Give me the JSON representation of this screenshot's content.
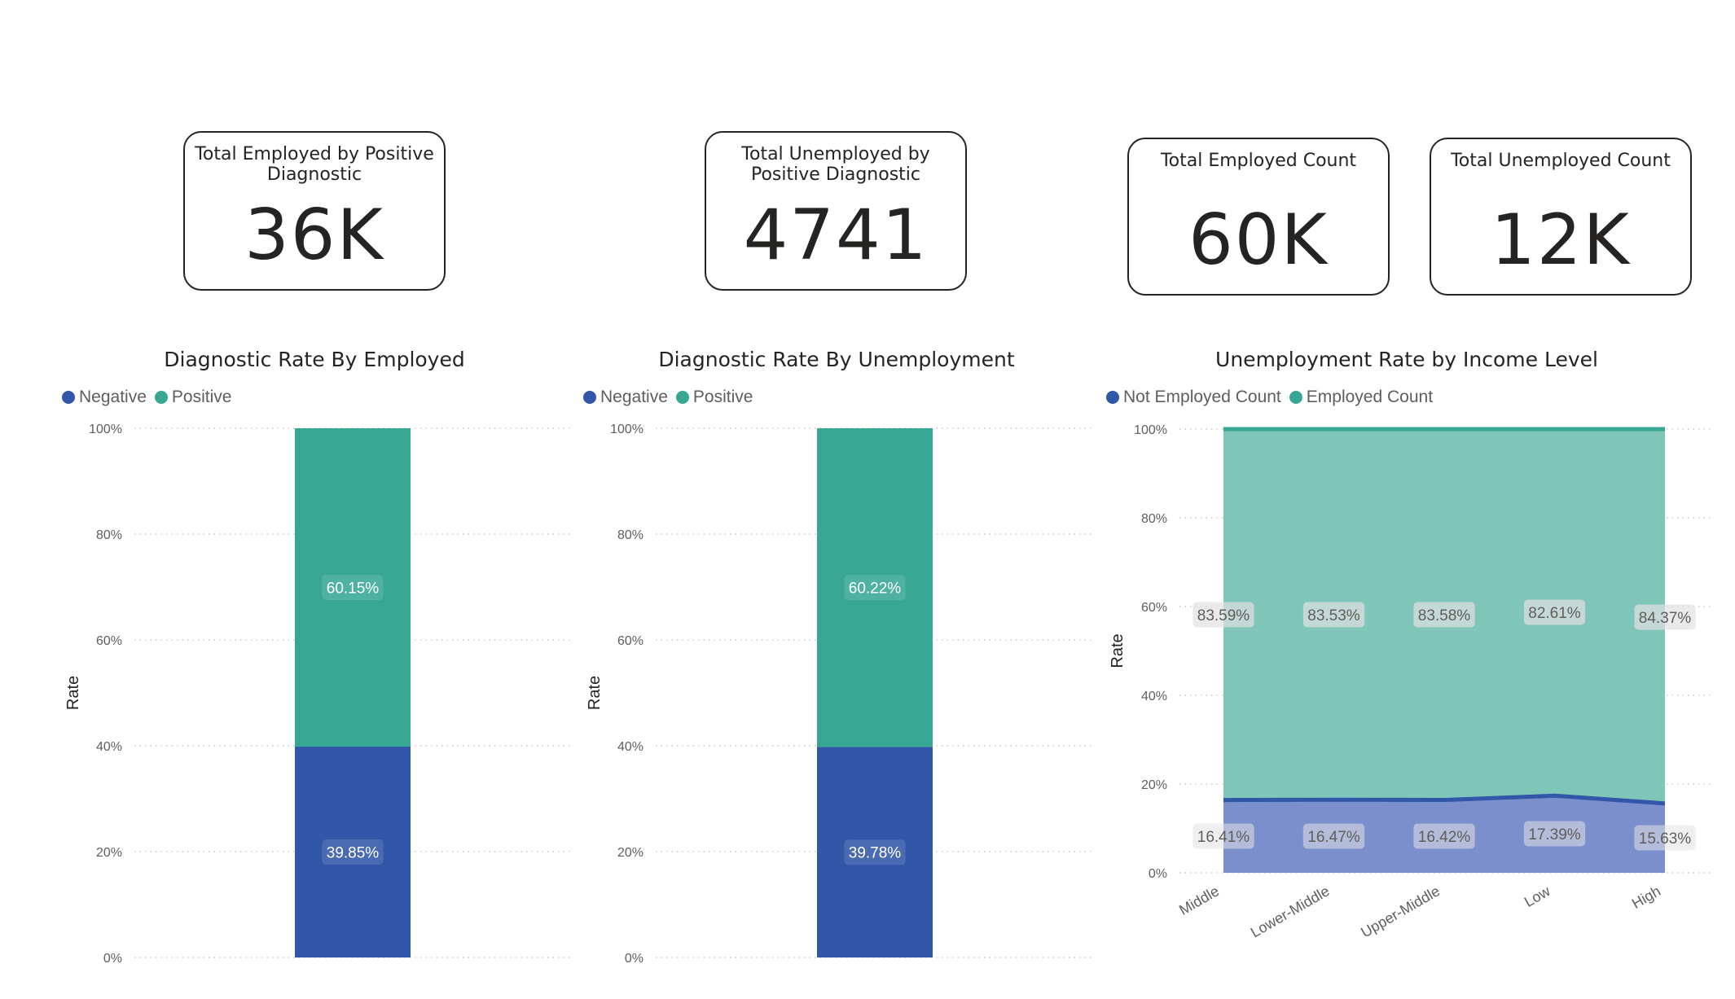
{
  "cards": [
    {
      "title": "Total Employed by Positive Diagnostic",
      "value": "36K"
    },
    {
      "title": "Total Unemployed by Positive Diagnostic",
      "value": "4741"
    },
    {
      "title": "Total Employed Count",
      "value": "60K"
    },
    {
      "title": "Total Unemployed Count",
      "value": "12K"
    }
  ],
  "colors": {
    "negative": "#3256a8",
    "positive": "#37a794",
    "area_positive": "#7fc6b8",
    "area_negative": "#7a8fcc",
    "line_positive": "#37a794",
    "line_negative": "#3256a8"
  },
  "chart_data": [
    {
      "type": "bar",
      "stacked": "100%",
      "title": "Diagnostic Rate By Employed",
      "ylabel": "Rate",
      "xlabel": "",
      "ylim": [
        0,
        100
      ],
      "yticks": [
        "0%",
        "20%",
        "40%",
        "60%",
        "80%",
        "100%"
      ],
      "legend_position": "top-left",
      "series": [
        {
          "name": "Negative",
          "values": [
            39.85
          ],
          "labels": [
            "39.85%"
          ]
        },
        {
          "name": "Positive",
          "values": [
            60.15
          ],
          "labels": [
            "60.15%"
          ]
        }
      ],
      "grid": true
    },
    {
      "type": "bar",
      "stacked": "100%",
      "title": "Diagnostic Rate By Unemployment",
      "ylabel": "Rate",
      "xlabel": "",
      "ylim": [
        0,
        100
      ],
      "yticks": [
        "0%",
        "20%",
        "40%",
        "60%",
        "80%",
        "100%"
      ],
      "legend_position": "top-left",
      "series": [
        {
          "name": "Negative",
          "values": [
            39.78
          ],
          "labels": [
            "39.78%"
          ]
        },
        {
          "name": "Positive",
          "values": [
            60.22
          ],
          "labels": [
            "60.22%"
          ]
        }
      ],
      "grid": true
    },
    {
      "type": "area",
      "stacked": "100%",
      "title": "Unemployment Rate by Income Level",
      "ylabel": "Rate",
      "xlabel": "",
      "ylim": [
        0,
        100
      ],
      "yticks": [
        "0%",
        "20%",
        "40%",
        "60%",
        "80%",
        "100%"
      ],
      "legend_position": "top-left",
      "categories": [
        "Middle",
        "Lower-Middle",
        "Upper-Middle",
        "Low",
        "High"
      ],
      "series": [
        {
          "name": "Not Employed Count",
          "values": [
            16.41,
            16.47,
            16.42,
            17.39,
            15.63
          ],
          "labels": [
            "16.41%",
            "16.47%",
            "16.42%",
            "17.39%",
            "15.63%"
          ]
        },
        {
          "name": "Employed Count",
          "values": [
            83.59,
            83.53,
            83.58,
            82.61,
            84.37
          ],
          "labels": [
            "83.59%",
            "83.53%",
            "83.58%",
            "82.61%",
            "84.37%"
          ]
        }
      ],
      "grid": true
    }
  ]
}
